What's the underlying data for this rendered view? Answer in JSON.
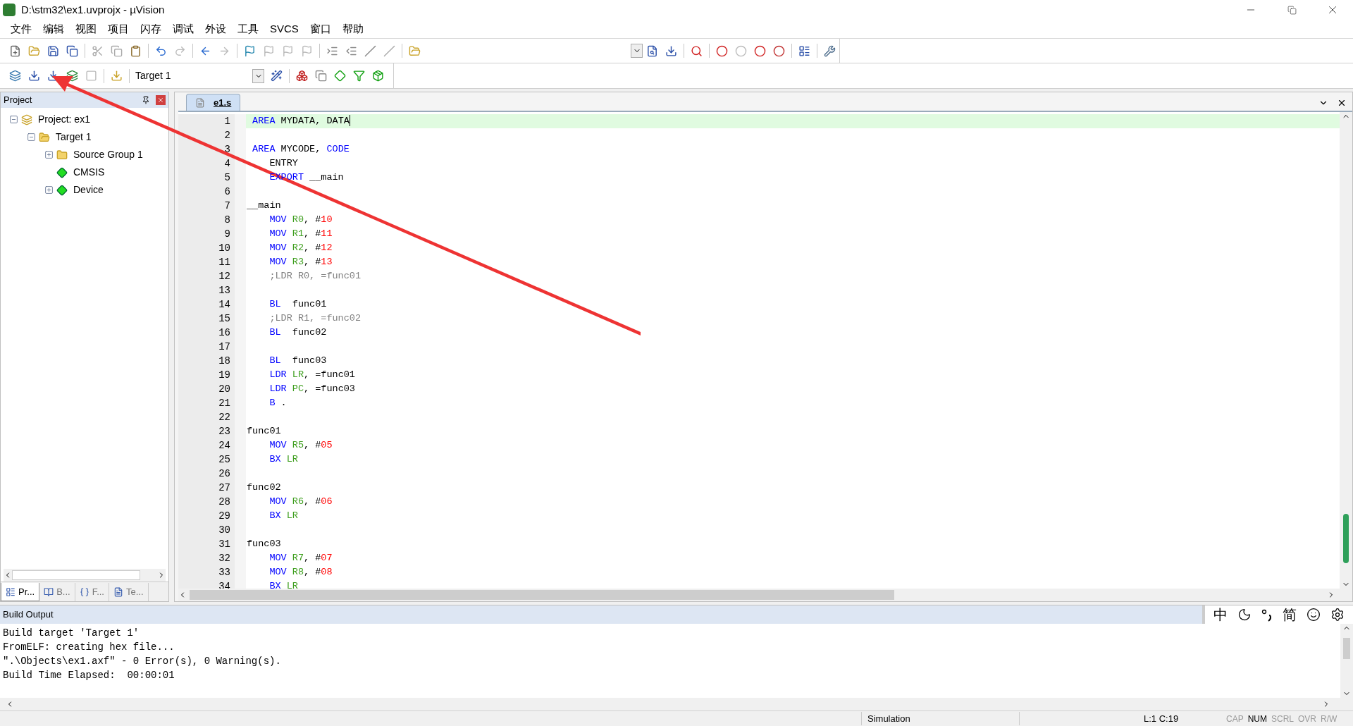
{
  "window": {
    "title": "D:\\stm32\\ex1.uvprojx - µVision"
  },
  "menu": [
    "文件",
    "编辑",
    "视图",
    "项目",
    "闪存",
    "调试",
    "外设",
    "工具",
    "SVCS",
    "窗口",
    "帮助"
  ],
  "toolbar2": {
    "target": "Target 1"
  },
  "project_panel": {
    "title": "Project",
    "tree": [
      {
        "label": "Project: ex1",
        "kind": "project",
        "expanded": true,
        "children": [
          {
            "label": "Target 1",
            "kind": "target",
            "expanded": true,
            "children": [
              {
                "label": "Source Group 1",
                "kind": "folder",
                "expanded": false
              },
              {
                "label": "CMSIS",
                "kind": "component"
              },
              {
                "label": "Device",
                "kind": "component",
                "expanded": false
              }
            ]
          }
        ]
      }
    ],
    "tabs": [
      {
        "label": "Pr...",
        "kind": "project",
        "selected": true
      },
      {
        "label": "B...",
        "kind": "books",
        "selected": false
      },
      {
        "label": "F...",
        "kind": "functions",
        "selected": false
      },
      {
        "label": "Te...",
        "kind": "templates",
        "selected": false
      }
    ]
  },
  "editor": {
    "tabs": [
      {
        "label": "e1.s",
        "selected": true
      }
    ],
    "lines": [
      {
        "number": "1",
        "current": true,
        "tokens": [
          {
            "kind": "kw",
            "text": " AREA"
          },
          {
            "kind": "plain",
            "text": " MYDATA, DATA"
          }
        ]
      },
      {
        "number": "2",
        "current": false
      },
      {
        "number": "3",
        "current": false,
        "tokens": [
          {
            "kind": "kw",
            "text": " AREA"
          },
          {
            "kind": "plain",
            "text": " MYCODE, "
          },
          {
            "kind": "kw",
            "text": "CODE"
          }
        ]
      },
      {
        "number": "4",
        "current": false,
        "tokens": [
          {
            "kind": "plain",
            "text": "    ENTRY"
          }
        ]
      },
      {
        "number": "5",
        "current": false,
        "tokens": [
          {
            "kind": "kw",
            "text": "    EXPORT"
          },
          {
            "kind": "plain",
            "text": " __main"
          }
        ]
      },
      {
        "number": "6",
        "current": false
      },
      {
        "number": "7",
        "current": false,
        "tokens": [
          {
            "kind": "plain",
            "text": "__main"
          }
        ]
      },
      {
        "number": "8",
        "current": false,
        "tokens": [
          {
            "kind": "kw",
            "text": "    MOV"
          },
          {
            "kind": "reg",
            "text": " R0"
          },
          {
            "kind": "plain",
            "text": ", #"
          },
          {
            "kind": "num",
            "text": "10"
          }
        ]
      },
      {
        "number": "9",
        "current": false,
        "tokens": [
          {
            "kind": "kw",
            "text": "    MOV"
          },
          {
            "kind": "reg",
            "text": " R1"
          },
          {
            "kind": "plain",
            "text": ", #"
          },
          {
            "kind": "num",
            "text": "11"
          }
        ]
      },
      {
        "number": "10",
        "current": false,
        "tokens": [
          {
            "kind": "kw",
            "text": "    MOV"
          },
          {
            "kind": "reg",
            "text": " R2"
          },
          {
            "kind": "plain",
            "text": ", #"
          },
          {
            "kind": "num",
            "text": "12"
          }
        ]
      },
      {
        "number": "11",
        "current": false,
        "tokens": [
          {
            "kind": "kw",
            "text": "    MOV"
          },
          {
            "kind": "reg",
            "text": " R3"
          },
          {
            "kind": "plain",
            "text": ", #"
          },
          {
            "kind": "num",
            "text": "13"
          }
        ]
      },
      {
        "number": "12",
        "current": false,
        "tokens": [
          {
            "kind": "comment",
            "text": "    ;LDR R0, =func01"
          }
        ]
      },
      {
        "number": "13",
        "current": false
      },
      {
        "number": "14",
        "current": false,
        "tokens": [
          {
            "kind": "kw",
            "text": "    BL"
          },
          {
            "kind": "plain",
            "text": "  func01"
          }
        ]
      },
      {
        "number": "15",
        "current": false,
        "tokens": [
          {
            "kind": "comment",
            "text": "    ;LDR R1, =func02"
          }
        ]
      },
      {
        "number": "16",
        "current": false,
        "tokens": [
          {
            "kind": "kw",
            "text": "    BL"
          },
          {
            "kind": "plain",
            "text": "  func02"
          }
        ]
      },
      {
        "number": "17",
        "current": false
      },
      {
        "number": "18",
        "current": false,
        "tokens": [
          {
            "kind": "kw",
            "text": "    BL"
          },
          {
            "kind": "plain",
            "text": "  func03"
          }
        ]
      },
      {
        "number": "19",
        "current": false,
        "tokens": [
          {
            "kind": "kw",
            "text": "    LDR"
          },
          {
            "kind": "reg",
            "text": " LR"
          },
          {
            "kind": "plain",
            "text": ", =func01"
          }
        ]
      },
      {
        "number": "20",
        "current": false,
        "tokens": [
          {
            "kind": "kw",
            "text": "    LDR"
          },
          {
            "kind": "reg",
            "text": " PC"
          },
          {
            "kind": "plain",
            "text": ", =func03"
          }
        ]
      },
      {
        "number": "21",
        "current": false,
        "tokens": [
          {
            "kind": "kw",
            "text": "    B"
          },
          {
            "kind": "plain",
            "text": " ."
          }
        ]
      },
      {
        "number": "22",
        "current": false
      },
      {
        "number": "23",
        "current": false,
        "tokens": [
          {
            "kind": "plain",
            "text": "func01"
          }
        ]
      },
      {
        "number": "24",
        "current": false,
        "tokens": [
          {
            "kind": "kw",
            "text": "    MOV"
          },
          {
            "kind": "reg",
            "text": " R5"
          },
          {
            "kind": "plain",
            "text": ", #"
          },
          {
            "kind": "num",
            "text": "05"
          }
        ]
      },
      {
        "number": "25",
        "current": false,
        "tokens": [
          {
            "kind": "kw",
            "text": "    BX"
          },
          {
            "kind": "reg",
            "text": " LR"
          }
        ]
      },
      {
        "number": "26",
        "current": false
      },
      {
        "number": "27",
        "current": false,
        "tokens": [
          {
            "kind": "plain",
            "text": "func02"
          }
        ]
      },
      {
        "number": "28",
        "current": false,
        "tokens": [
          {
            "kind": "kw",
            "text": "    MOV"
          },
          {
            "kind": "reg",
            "text": " R6"
          },
          {
            "kind": "plain",
            "text": ", #"
          },
          {
            "kind": "num",
            "text": "06"
          }
        ]
      },
      {
        "number": "29",
        "current": false,
        "tokens": [
          {
            "kind": "kw",
            "text": "    BX"
          },
          {
            "kind": "reg",
            "text": " LR"
          }
        ]
      },
      {
        "number": "30",
        "current": false
      },
      {
        "number": "31",
        "current": false,
        "tokens": [
          {
            "kind": "plain",
            "text": "func03"
          }
        ]
      },
      {
        "number": "32",
        "current": false,
        "tokens": [
          {
            "kind": "kw",
            "text": "    MOV"
          },
          {
            "kind": "reg",
            "text": " R7"
          },
          {
            "kind": "plain",
            "text": ", #"
          },
          {
            "kind": "num",
            "text": "07"
          }
        ]
      },
      {
        "number": "33",
        "current": false,
        "tokens": [
          {
            "kind": "kw",
            "text": "    MOV"
          },
          {
            "kind": "reg",
            "text": " R8"
          },
          {
            "kind": "plain",
            "text": ", #"
          },
          {
            "kind": "num",
            "text": "08"
          }
        ]
      },
      {
        "number": "34",
        "current": false,
        "tokens": [
          {
            "kind": "kw",
            "text": "    BX"
          },
          {
            "kind": "reg",
            "text": " LR"
          }
        ]
      }
    ]
  },
  "build_output": {
    "title": "Build Output",
    "lines": [
      "Build target 'Target 1'",
      "FromELF: creating hex file...",
      "\".\\Objects\\ex1.axf\" - 0 Error(s), 0 Warning(s).",
      "Build Time Elapsed:  00:00:01"
    ]
  },
  "ime_bar": {
    "chinese_mode": "中",
    "simplified": "简"
  },
  "status_bar": {
    "mode": "Simulation",
    "position": "L:1 C:19",
    "indicators": [
      {
        "label": "CAP",
        "on": false
      },
      {
        "label": "NUM",
        "on": true
      },
      {
        "label": "SCRL",
        "on": false
      },
      {
        "label": "OVR",
        "on": false
      },
      {
        "label": "R/W",
        "on": false
      }
    ]
  }
}
